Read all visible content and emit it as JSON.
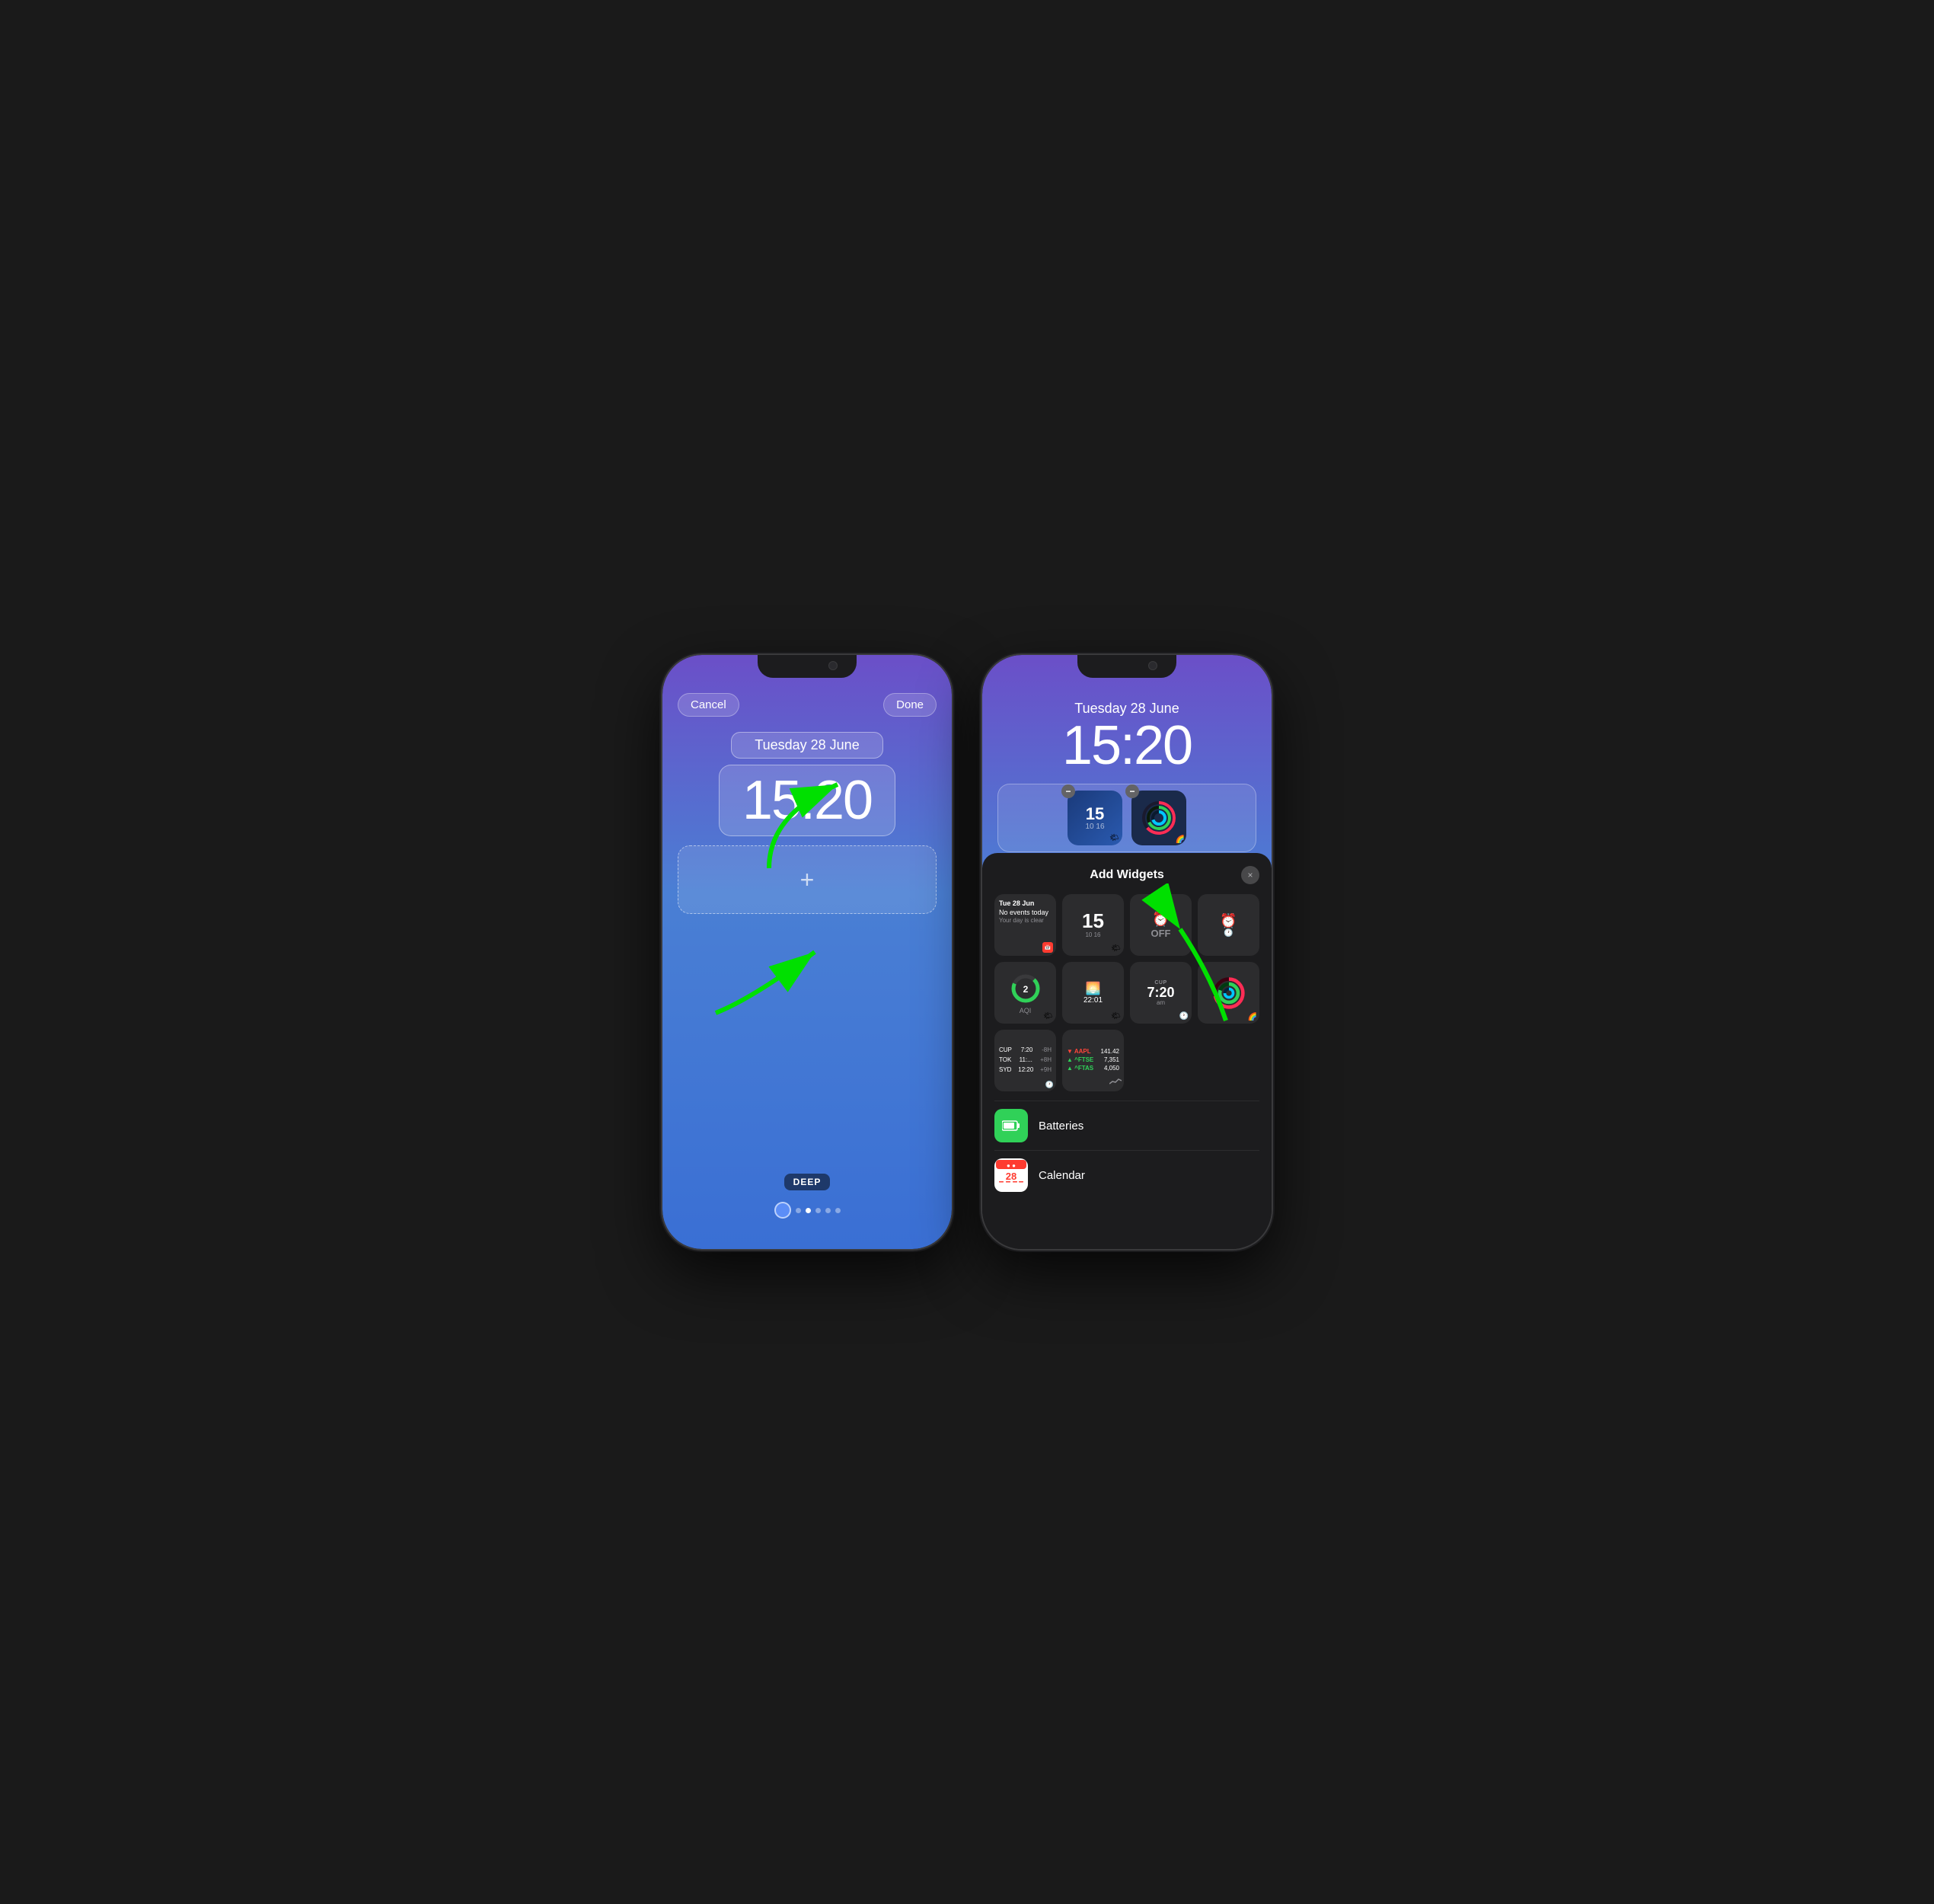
{
  "phone1": {
    "topbar": {
      "cancel_label": "Cancel",
      "done_label": "Done"
    },
    "date": "Tuesday 28 June",
    "time": "15:20",
    "add_widget_placeholder": "+",
    "wallpaper_label": "DEEP",
    "page_dots_count": 6,
    "active_dot_index": 0
  },
  "phone2": {
    "date": "Tuesday 28 June",
    "time": "15:20",
    "widget_row": {
      "clock_num": "15",
      "clock_sub": "10  16"
    },
    "panel": {
      "title": "Add Widgets",
      "close_label": "×",
      "widgets": {
        "calendar": {
          "date_line": "Tue 28 Jun",
          "events_line": "No events today",
          "events_sub": "Your day is clear"
        },
        "clock_num": "15",
        "clock_sub": "10  16",
        "alarm": "OFF",
        "aqi": {
          "value": "2",
          "label": "AQI"
        },
        "sunrise": "22:01",
        "cup_time": "7:20",
        "cup_suffix": "am",
        "worldclock": {
          "rows": [
            {
              "city": "CUP",
              "time": "7:20",
              "offset": "-8H"
            },
            {
              "city": "TOK",
              "time": "11:...",
              "offset": "+8H"
            },
            {
              "city": "SYD",
              "time": "12:20",
              "offset": "+9H"
            }
          ]
        },
        "stocks": {
          "rows": [
            {
              "ticker": "▼ AAPL",
              "value": "141.42",
              "change": ""
            },
            {
              "ticker": "▲ ^FTSE",
              "value": "7,351",
              "change": ""
            },
            {
              "ticker": "▲ ^FTAS",
              "value": "4,050",
              "change": ""
            }
          ]
        }
      },
      "apps": [
        {
          "name": "Batteries",
          "icon_type": "batteries"
        },
        {
          "name": "Calendar",
          "icon_type": "calendar"
        }
      ]
    }
  },
  "arrows": {
    "arrow1_label": "arrow pointing to date widget",
    "arrow2_label": "arrow pointing to add widget area",
    "arrow3_label": "arrow pointing to widgets from panel"
  }
}
